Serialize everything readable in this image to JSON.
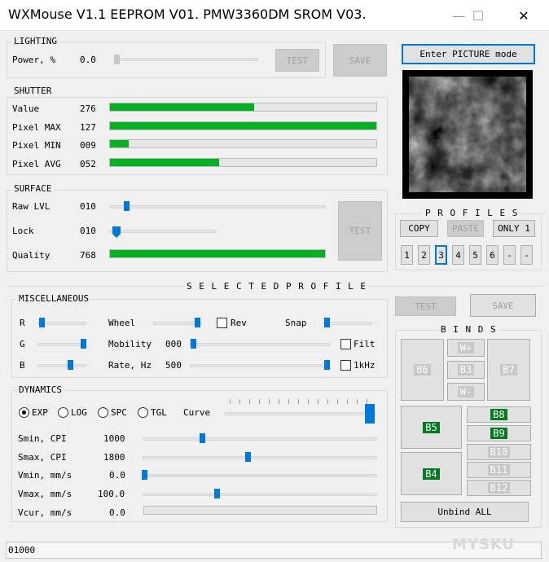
{
  "window": {
    "title": "WXMouse V1.1 EEPROM V01. PMW3360DM SROM V03.",
    "minimize_glyph": "—",
    "maximize_glyph": "☐",
    "close_glyph": "✕"
  },
  "lighting": {
    "group_label": "LIGHTING",
    "power_label": "Power, %",
    "power_value": "0.0",
    "power_level": 0.0,
    "test_label": "TEST",
    "save_label": "SAVE"
  },
  "shutter": {
    "group_label": "SHUTTER",
    "rows": [
      {
        "label": "Value",
        "value": "276",
        "fill": 0.54
      },
      {
        "label": "Pixel MAX",
        "value": "127",
        "fill": 1.0
      },
      {
        "label": "Pixel MIN",
        "value": "009",
        "fill": 0.07
      },
      {
        "label": "Pixel AVG",
        "value": "052",
        "fill": 0.41
      }
    ]
  },
  "surface": {
    "group_label": "SURFACE",
    "raw_label": "Raw LVL",
    "raw_value": "010",
    "lock_label": "Lock",
    "lock_value": "010",
    "quality_label": "Quality",
    "quality_value": "768",
    "quality_fill": 1.0,
    "test_label": "TEST"
  },
  "picture": {
    "button_label": "Enter PICTURE mode"
  },
  "profiles": {
    "header": "P R O F I L E S",
    "copy_label": "COPY",
    "paste_label": "PASTE",
    "only_label": "ONLY 1",
    "slots": [
      "1",
      "2",
      "3",
      "4",
      "5",
      "6",
      "-",
      "-"
    ],
    "active_slot": "3"
  },
  "selected_profile": {
    "header": "S E L E C T E D   P R O F I L E",
    "test_label": "TEST",
    "save_label": "SAVE"
  },
  "misc": {
    "group_label": "MISCELLANEOUS",
    "r_label": "R",
    "g_label": "G",
    "b_label": "B",
    "wheel_label": "Wheel",
    "rev_label": "Rev",
    "snap_label": "Snap",
    "mobility_label": "Mobility",
    "mobility_value": "000",
    "filt_label": "Filt",
    "rate_label": "Rate, Hz",
    "rate_value": "500",
    "khz_label": "1kHz"
  },
  "dynamics": {
    "group_label": "DYNAMICS",
    "modes": [
      "EXP",
      "LOG",
      "SPC",
      "TGL"
    ],
    "selected_mode": "EXP",
    "curve_label": "Curve",
    "rows": [
      {
        "label": "Smin, CPI",
        "value": "1000"
      },
      {
        "label": "Smax, CPI",
        "value": "1800"
      },
      {
        "label": "Vmin, mm/s",
        "value": "0.0"
      },
      {
        "label": "Vmax, mm/s",
        "value": "100.0"
      },
      {
        "label": "Vcur, mm/s",
        "value": "0.0"
      }
    ]
  },
  "binds": {
    "header": "B I N D S",
    "b6": "B6",
    "wplus": "W+",
    "b3": "B3",
    "wminus": "W-",
    "b7": "B7",
    "b5": "B5",
    "b4": "B4",
    "b8": "B8",
    "b9": "B9",
    "b10": "B10",
    "b11": "B11",
    "b12": "B12",
    "unbind_label": "Unbind ALL"
  },
  "status": {
    "text": "01000"
  },
  "watermark": "MYSKU"
}
